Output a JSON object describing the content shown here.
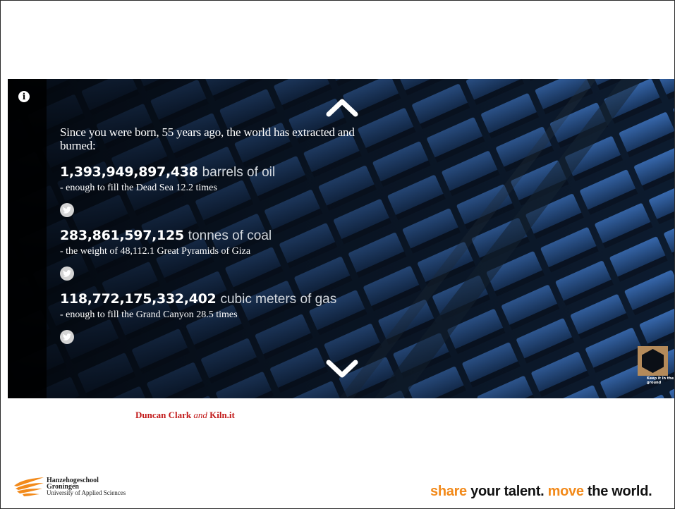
{
  "hero": {
    "intro": "Since you were born, 55 years ago, the world has extracted and burned:",
    "stats": [
      {
        "number": "1,393,949,897,438",
        "unit": "barrels of oil",
        "desc": "- enough to fill the Dead Sea 12.2 times"
      },
      {
        "number": "283,861,597,125",
        "unit": "tonnes of coal",
        "desc": "- the weight of 48,112.1 Great Pyramids of Giza"
      },
      {
        "number": "118,772,175,332,402",
        "unit": "cubic meters of gas",
        "desc": "- enough to fill the Grand Canyon 28.5 times"
      }
    ],
    "info_icon": "info-icon",
    "badge_text": "Keep it in the ground",
    "badge_color": "#b48a5a"
  },
  "credit": {
    "name1": "Duncan Clark",
    "connector": "and",
    "name2": "Kiln.it",
    "color": "#c21a1a"
  },
  "footer": {
    "logo_line1": "Hanzehogeschool",
    "logo_line2": "Groningen",
    "logo_line3": "University of Applied Sciences",
    "slogan_part1": "share",
    "slogan_part2": "your talent.",
    "slogan_part3": "move",
    "slogan_part4": "the world.",
    "accent_color": "#f28a1b"
  }
}
